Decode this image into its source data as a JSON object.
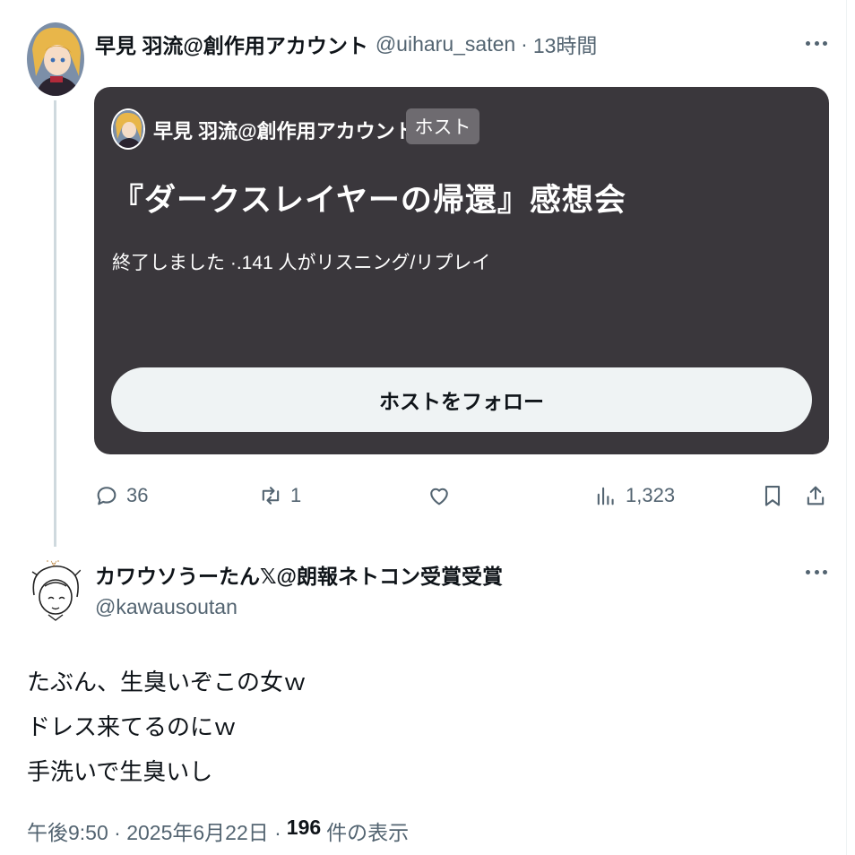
{
  "tweet": {
    "author_name": "早見 羽流@創作用アカウント",
    "author_handle": "@uiharu_saten",
    "separator": "·",
    "time_ago": "13時間",
    "space_card": {
      "host_name": "早見 羽流@創作用アカウント",
      "host_badge": "ホスト",
      "title": "『ダークスレイヤーの帰還』感想会",
      "status": "終了しました ·.141 人がリスニング/リプレイ",
      "follow_button": "ホストをフォロー"
    },
    "actions": {
      "replies": "36",
      "reposts": "1",
      "views": "1,323"
    }
  },
  "reply": {
    "author_name": "カワウソうーたん𝕏@朗報ネトコン受賞受賞",
    "author_handle": "@kawausoutan",
    "text_lines": [
      "たぶん、生臭いぞこの女ｗ",
      "ドレス来てるのにｗ",
      "手洗いで生臭いし"
    ],
    "timestamp": "午後9:50 · 2025年6月22日 ·",
    "views_count": "196",
    "views_label": "件の表示"
  },
  "colors": {
    "card_bg": "#3a373c",
    "muted": "#536471",
    "text": "#0f1419",
    "button_bg": "#eff3f4"
  },
  "icons": [
    "more-icon",
    "reply-icon",
    "repost-icon",
    "like-icon",
    "views-icon",
    "bookmark-icon",
    "share-icon"
  ]
}
